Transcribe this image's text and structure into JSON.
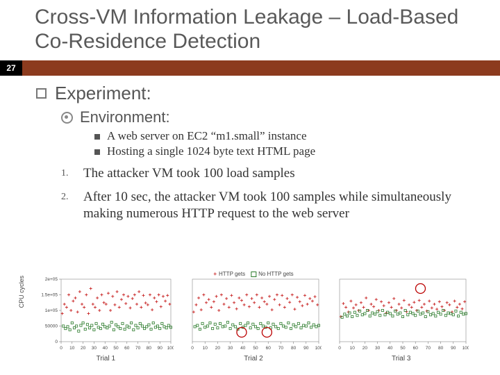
{
  "page_number": "27",
  "title": "Cross-VM Information Leakage – Load-Based Co-Residence Detection",
  "h1": "Experiment:",
  "h2": "Environment:",
  "env_items": [
    "A web server on EC2 “m1.small” instance",
    "Hosting a single 1024 byte text HTML page"
  ],
  "steps": [
    "The attacker VM took 100 load samples",
    "After 10 sec, the attacker VM took 100 samples while simultaneously making numerous HTTP request to the web server"
  ],
  "chart_data": [
    {
      "type": "scatter",
      "title": "Trial 1",
      "xlabel": "Trial 1",
      "ylabel": "CPU cycles",
      "xlim": [
        0,
        100
      ],
      "ylim": [
        0,
        200000
      ],
      "xticks": [
        0,
        10,
        20,
        30,
        40,
        50,
        60,
        70,
        80,
        90,
        100
      ],
      "yticks": [
        0,
        50000,
        100000,
        150000,
        200000
      ],
      "ytick_labels": [
        "0",
        "50000",
        "1e+05",
        "1.5e+05",
        "2e+05"
      ],
      "legend": [
        {
          "name": "HTTP gets",
          "marker": "cross",
          "color": "#cc3333"
        },
        {
          "name": "No HTTP gets",
          "marker": "square",
          "color": "#2a7a2a"
        }
      ],
      "series": [
        {
          "name": "HTTP gets",
          "marker": "cross",
          "color": "#cc3333",
          "x": [
            1,
            3,
            5,
            7,
            9,
            11,
            13,
            15,
            17,
            19,
            21,
            23,
            25,
            27,
            29,
            31,
            33,
            35,
            37,
            39,
            41,
            43,
            45,
            47,
            49,
            51,
            53,
            55,
            57,
            59,
            61,
            63,
            65,
            67,
            69,
            71,
            73,
            75,
            77,
            79,
            81,
            83,
            85,
            87,
            89,
            91,
            93,
            95,
            97,
            99
          ],
          "y": [
            90000,
            120000,
            110000,
            150000,
            100000,
            130000,
            140000,
            95000,
            160000,
            120000,
            110000,
            150000,
            90000,
            170000,
            120000,
            110000,
            140000,
            100000,
            150000,
            125000,
            120000,
            155000,
            100000,
            145000,
            118000,
            160000,
            110000,
            135000,
            150000,
            122000,
            145000,
            108000,
            138000,
            150000,
            120000,
            160000,
            110000,
            148000,
            124000,
            118000,
            150000,
            102000,
            140000,
            128000,
            150000,
            112000,
            145000,
            130000,
            148000,
            120000
          ]
        },
        {
          "name": "No HTTP gets",
          "marker": "square",
          "color": "#2a7a2a",
          "x": [
            2,
            4,
            6,
            8,
            10,
            12,
            14,
            16,
            18,
            20,
            22,
            24,
            26,
            28,
            30,
            32,
            34,
            36,
            38,
            40,
            42,
            44,
            46,
            48,
            50,
            52,
            54,
            56,
            58,
            60,
            62,
            64,
            66,
            68,
            70,
            72,
            74,
            76,
            78,
            80,
            82,
            84,
            86,
            88,
            90,
            92,
            94,
            96,
            98,
            100
          ],
          "y": [
            50000,
            42000,
            48000,
            38000,
            60000,
            44000,
            50000,
            34000,
            52000,
            60000,
            40000,
            55000,
            44000,
            52000,
            38000,
            58000,
            46000,
            42000,
            56000,
            48000,
            44000,
            50000,
            62000,
            38000,
            54000,
            48000,
            42000,
            58000,
            40000,
            50000,
            46000,
            60000,
            38000,
            52000,
            44000,
            58000,
            50000,
            42000,
            48000,
            54000,
            40000,
            60000,
            46000,
            50000,
            42000,
            58000,
            48000,
            44000,
            52000,
            46000
          ]
        }
      ]
    },
    {
      "type": "scatter",
      "title": "Trial 2",
      "xlabel": "Trial 2",
      "ylabel": "",
      "xlim": [
        0,
        100
      ],
      "ylim": [
        0,
        200000
      ],
      "xticks": [
        0,
        10,
        20,
        30,
        40,
        50,
        60,
        70,
        80,
        90,
        100
      ],
      "series": [
        {
          "name": "HTTP gets",
          "marker": "cross",
          "color": "#cc3333",
          "x": [
            1,
            3,
            5,
            7,
            9,
            11,
            13,
            15,
            17,
            19,
            21,
            23,
            25,
            27,
            29,
            31,
            33,
            35,
            37,
            39,
            41,
            43,
            45,
            47,
            49,
            51,
            53,
            55,
            57,
            59,
            61,
            63,
            65,
            67,
            69,
            71,
            73,
            75,
            77,
            79,
            81,
            83,
            85,
            87,
            89,
            91,
            93,
            95,
            97,
            99
          ],
          "y": [
            95000,
            118000,
            140000,
            102000,
            150000,
            125000,
            135000,
            110000,
            128000,
            145000,
            100000,
            150000,
            120000,
            138000,
            110000,
            148000,
            125000,
            105000,
            140000,
            132000,
            118000,
            150000,
            112000,
            138000,
            125000,
            150000,
            110000,
            140000,
            128000,
            120000,
            145000,
            102000,
            135000,
            150000,
            118000,
            148000,
            110000,
            138000,
            126000,
            150000,
            104000,
            142000,
            128000,
            115000,
            148000,
            120000,
            138000,
            130000,
            144000,
            118000
          ]
        },
        {
          "name": "No HTTP gets",
          "marker": "square",
          "color": "#2a7a2a",
          "x": [
            2,
            4,
            6,
            8,
            10,
            12,
            14,
            16,
            18,
            20,
            22,
            24,
            26,
            28,
            30,
            32,
            34,
            36,
            38,
            40,
            42,
            44,
            46,
            48,
            50,
            52,
            54,
            56,
            58,
            60,
            62,
            64,
            66,
            68,
            70,
            72,
            74,
            76,
            78,
            80,
            82,
            84,
            86,
            88,
            90,
            92,
            94,
            96,
            98,
            100
          ],
          "y": [
            48000,
            52000,
            40000,
            58000,
            46000,
            50000,
            60000,
            42000,
            56000,
            44000,
            58000,
            48000,
            50000,
            62000,
            42000,
            54000,
            48000,
            40000,
            58000,
            46000,
            52000,
            60000,
            44000,
            56000,
            48000,
            42000,
            58000,
            50000,
            46000,
            60000,
            44000,
            56000,
            48000,
            42000,
            58000,
            50000,
            46000,
            60000,
            42000,
            54000,
            48000,
            58000,
            44000,
            52000,
            50000,
            60000,
            46000,
            54000,
            48000,
            52000
          ]
        }
      ],
      "annotations": [
        {
          "type": "circle",
          "x": 39,
          "y": 30000,
          "r": 7
        },
        {
          "type": "circle",
          "x": 59,
          "y": 30000,
          "r": 7
        }
      ]
    },
    {
      "type": "scatter",
      "title": "Trial 3",
      "xlabel": "Trial 3",
      "ylabel": "",
      "xlim": [
        0,
        100
      ],
      "ylim": [
        0,
        200000
      ],
      "xticks": [
        0,
        10,
        20,
        30,
        40,
        50,
        60,
        70,
        80,
        90,
        100
      ],
      "series": [
        {
          "name": "HTTP gets",
          "marker": "cross",
          "color": "#cc3333",
          "x": [
            1,
            3,
            5,
            7,
            9,
            11,
            13,
            15,
            17,
            19,
            21,
            23,
            25,
            27,
            29,
            31,
            33,
            35,
            37,
            39,
            41,
            43,
            45,
            47,
            49,
            51,
            53,
            55,
            57,
            59,
            61,
            63,
            65,
            67,
            69,
            71,
            73,
            75,
            77,
            79,
            81,
            83,
            85,
            87,
            89,
            91,
            93,
            95,
            97,
            99
          ],
          "y": [
            80000,
            122000,
            110000,
            95000,
            130000,
            108000,
            118000,
            100000,
            125000,
            110000,
            140000,
            100000,
            120000,
            112000,
            135000,
            100000,
            128000,
            115000,
            92000,
            125000,
            110000,
            138000,
            100000,
            120000,
            108000,
            132000,
            96000,
            118000,
            110000,
            126000,
            100000,
            132000,
            110000,
            120000,
            98000,
            130000,
            108000,
            120000,
            104000,
            128000,
            112000,
            100000,
            125000,
            118000,
            95000,
            130000,
            110000,
            120000,
            105000,
            128000
          ]
        },
        {
          "name": "No HTTP gets",
          "marker": "square",
          "color": "#2a7a2a",
          "x": [
            2,
            4,
            6,
            8,
            10,
            12,
            14,
            16,
            18,
            20,
            22,
            24,
            26,
            28,
            30,
            32,
            34,
            36,
            38,
            40,
            42,
            44,
            46,
            48,
            50,
            52,
            54,
            56,
            58,
            60,
            62,
            64,
            66,
            68,
            70,
            72,
            74,
            76,
            78,
            80,
            82,
            84,
            86,
            88,
            90,
            92,
            94,
            96,
            98,
            100
          ],
          "y": [
            78000,
            88000,
            82000,
            92000,
            80000,
            94000,
            84000,
            98000,
            86000,
            90000,
            100000,
            82000,
            92000,
            88000,
            96000,
            84000,
            100000,
            86000,
            94000,
            90000,
            82000,
            98000,
            88000,
            92000,
            80000,
            100000,
            86000,
            94000,
            90000,
            84000,
            98000,
            88000,
            92000,
            80000,
            96000,
            86000,
            90000,
            82000,
            94000,
            88000,
            100000,
            84000,
            92000,
            90000,
            86000,
            98000,
            82000,
            94000,
            88000,
            90000
          ]
        }
      ],
      "annotations": [
        {
          "type": "circle",
          "x": 64,
          "y": 170000,
          "r": 7
        }
      ]
    }
  ]
}
